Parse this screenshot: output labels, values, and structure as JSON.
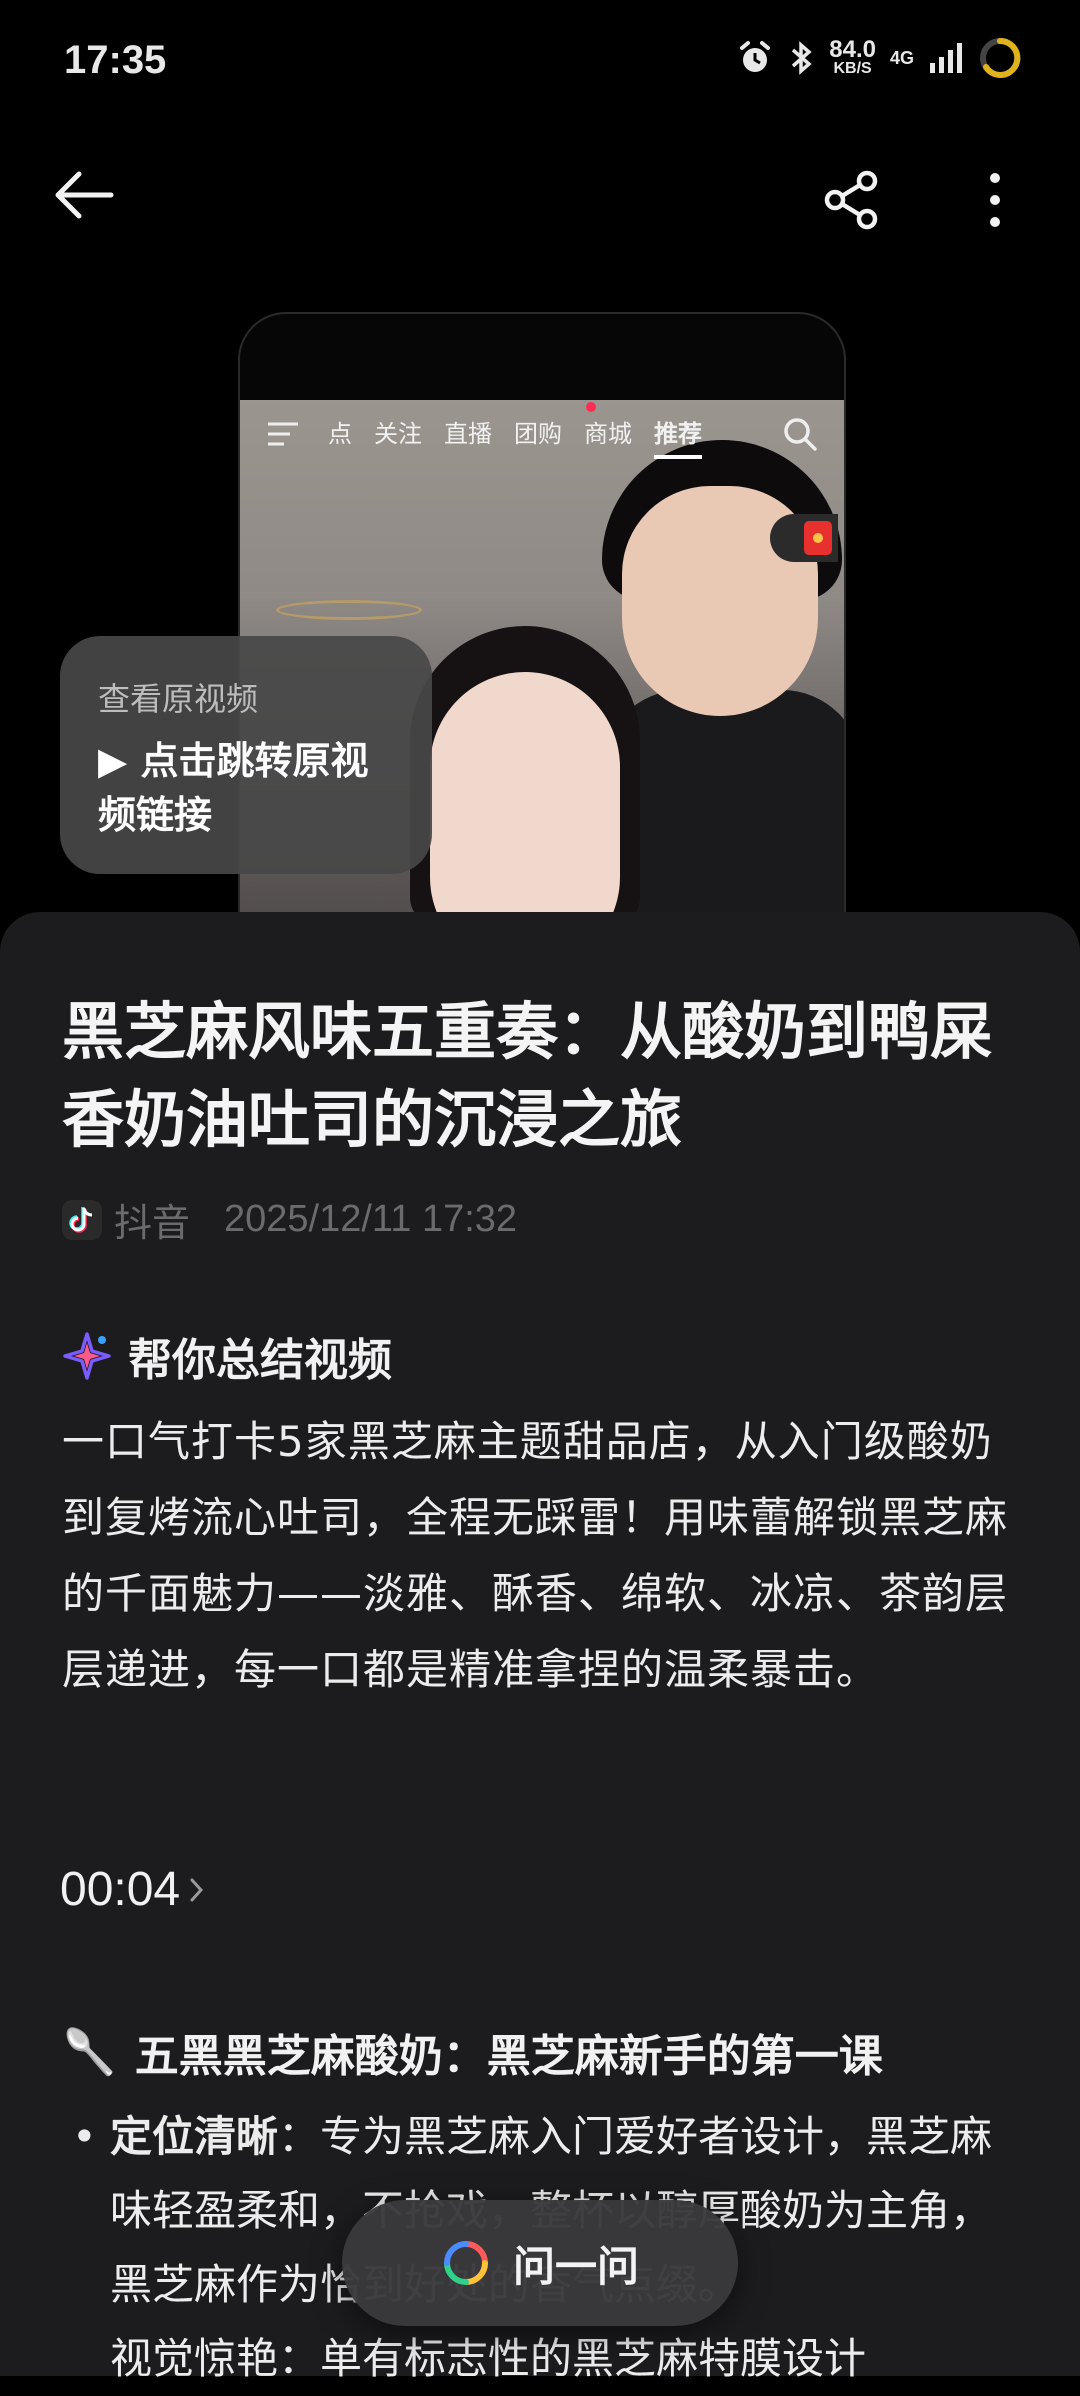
{
  "status_bar": {
    "time": "17:35",
    "speed_value": "84.0",
    "speed_unit": "KB/S",
    "network": "4G"
  },
  "toolbar": {
    "back_icon": "arrow-left-icon",
    "share_icon": "share-icon",
    "more_icon": "more-vertical-icon"
  },
  "preview": {
    "tabs": [
      "点",
      "关注",
      "直播",
      "团购",
      "商城",
      "推荐"
    ],
    "active_tab": "推荐",
    "overlay_label": "查看原视频",
    "overlay_link": "▶ 点击跳转原视频链接"
  },
  "article": {
    "title": "黑芝麻风味五重奏：从酸奶到鸭屎香奶油吐司的沉浸之旅",
    "source": "抖音",
    "date": "2025/12/11 17:32"
  },
  "summary": {
    "heading": "帮你总结视频",
    "text": "一口气打卡5家黑芝麻主题甜品店，从入门级酸奶到复烤流心吐司，全程无踩雷！用味蕾解锁黑芝麻的千面魅力——淡雅、酥香、绵软、冰凉、茶韵层层递进，每一口都是精准拿捏的温柔暴击。"
  },
  "timestamp": "00:04",
  "section": {
    "emoji": "🥄",
    "heading": "五黑黑芝麻酸奶：黑芝麻新手的第一课",
    "bullets": [
      {
        "term": "定位清晰",
        "text": "：专为黑芝麻入门爱好者设计，黑芝麻味轻盈柔和，不抢戏，整杯以醇厚酸奶为主角，黑芝麻作为恰到好处的香气点缀。"
      }
    ],
    "bullet2_partial": "视觉惊艳：单有标志性的黑芝麻特膜设计"
  },
  "ask_button": {
    "label": "问一问"
  }
}
